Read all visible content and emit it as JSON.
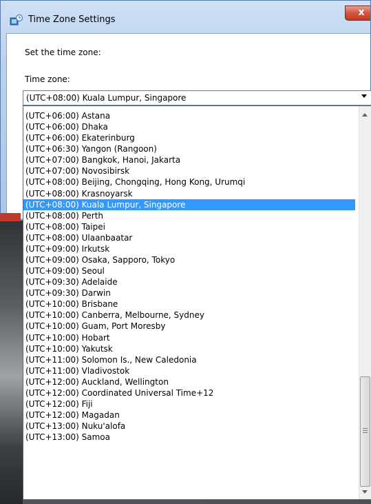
{
  "window": {
    "title": "Time Zone Settings",
    "close_glyph": "x"
  },
  "client": {
    "set_label": "Set the time zone:",
    "tz_label": "Time zone:"
  },
  "combo": {
    "value": "(UTC+08:00) Kuala Lumpur, Singapore"
  },
  "list": {
    "items": [
      "(UTC+06:00) Astana",
      "(UTC+06:00) Dhaka",
      "(UTC+06:00) Ekaterinburg",
      "(UTC+06:30) Yangon (Rangoon)",
      "(UTC+07:00) Bangkok, Hanoi, Jakarta",
      "(UTC+07:00) Novosibirsk",
      "(UTC+08:00) Beijing, Chongqing, Hong Kong, Urumqi",
      "(UTC+08:00) Krasnoyarsk",
      "(UTC+08:00) Kuala Lumpur, Singapore",
      "(UTC+08:00) Perth",
      "(UTC+08:00) Taipei",
      "(UTC+08:00) Ulaanbaatar",
      "(UTC+09:00) Irkutsk",
      "(UTC+09:00) Osaka, Sapporo, Tokyo",
      "(UTC+09:00) Seoul",
      "(UTC+09:30) Adelaide",
      "(UTC+09:30) Darwin",
      "(UTC+10:00) Brisbane",
      "(UTC+10:00) Canberra, Melbourne, Sydney",
      "(UTC+10:00) Guam, Port Moresby",
      "(UTC+10:00) Hobart",
      "(UTC+10:00) Yakutsk",
      "(UTC+11:00) Solomon Is., New Caledonia",
      "(UTC+11:00) Vladivostok",
      "(UTC+12:00) Auckland, Wellington",
      "(UTC+12:00) Coordinated Universal Time+12",
      "(UTC+12:00) Fiji",
      "(UTC+12:00) Magadan",
      "(UTC+13:00) Nuku'alofa",
      "(UTC+13:00) Samoa"
    ],
    "selected_index": 8
  },
  "colors": {
    "selection": "#3399ff",
    "close_button": "#c23a24"
  },
  "icons": {
    "title": "clock-globe-icon",
    "close": "close-icon",
    "combo_arrow": "chevron-down-icon",
    "scroll_up": "arrow-up-icon",
    "scroll_down": "arrow-down-icon"
  }
}
